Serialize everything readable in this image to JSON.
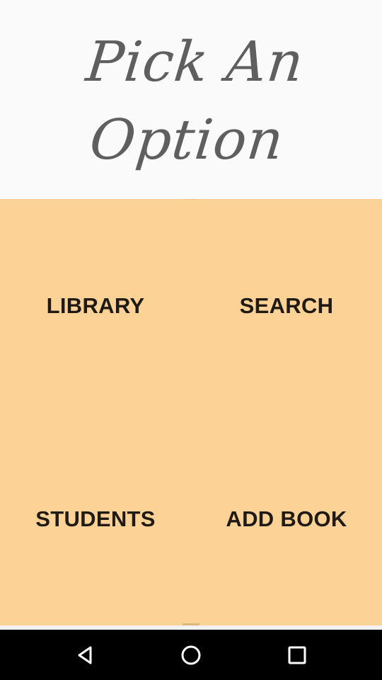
{
  "header": {
    "title_line_1": "Pick An",
    "title_line_2": "Option"
  },
  "options": [
    {
      "label": "LIBRARY"
    },
    {
      "label": "SEARCH"
    },
    {
      "label": "STUDENTS"
    },
    {
      "label": "ADD BOOK"
    }
  ],
  "navigation_bar": {
    "back_icon": "triangle-back-icon",
    "home_icon": "circle-home-icon",
    "recent_icon": "square-recent-apps-icon"
  },
  "colors": {
    "background": "#fafafa",
    "title": "#5f5f5f",
    "option_panel": "#fdd297",
    "option_text": "#1f1a14",
    "navigation_bar": "#000000",
    "navigation_icons": "#ffffff"
  }
}
